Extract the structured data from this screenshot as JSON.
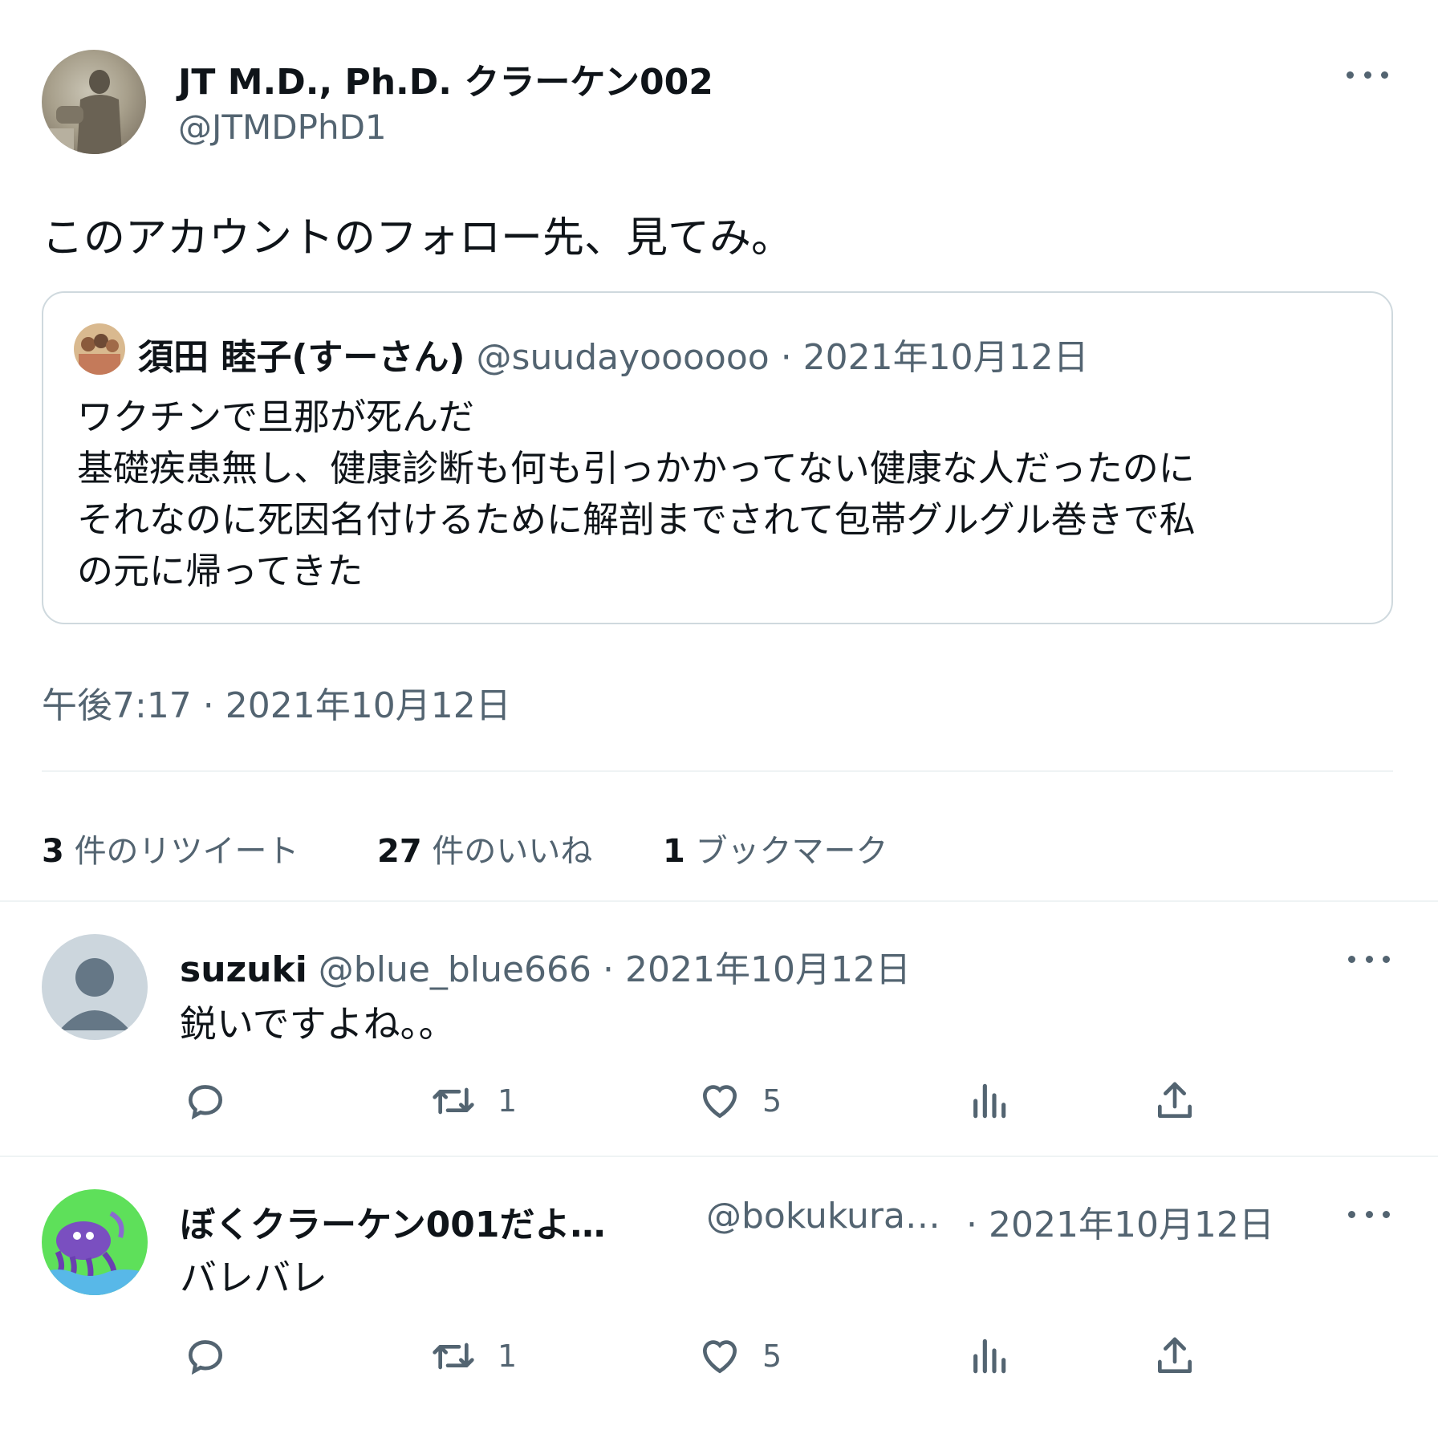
{
  "main_tweet": {
    "display_name": "JT M.D., Ph.D. クラーケン002",
    "handle": "@JTMDPhD1",
    "text": "このアカウントのフォロー先、見てみ。",
    "timestamp": "午後7:17 · 2021年10月12日"
  },
  "quoted_tweet": {
    "display_name": "須田 睦子(すーさん)",
    "handle": "@suudayoooooo",
    "date": "· 2021年10月12日",
    "lines": [
      "ワクチンで旦那が死んだ",
      "基礎疾患無し、健康診断も何も引っかかってない健康な人だったのに",
      "それなのに死因名付けるために解剖までされて包帯グルグル巻きで私",
      "の元に帰ってきた"
    ]
  },
  "stats": {
    "retweets_count": "3",
    "retweets_label": "件のリツイート",
    "likes_count": "27",
    "likes_label": "件のいいね",
    "bookmarks_count": "1",
    "bookmarks_label": "ブックマーク"
  },
  "replies": [
    {
      "display_name": "suzuki",
      "handle": "@blue_blue666",
      "date": "· 2021年10月12日",
      "text": "鋭いですよね。。",
      "retweets": "1",
      "likes": "5"
    },
    {
      "display_name": "ぼくクラーケン001だよ…",
      "handle": "@bokukura…",
      "date": "· 2021年10月12日",
      "text": "バレバレ",
      "retweets": "1",
      "likes": "5"
    }
  ],
  "icons": [
    "more-icon",
    "reply-icon",
    "retweet-icon",
    "like-icon",
    "views-icon",
    "share-icon"
  ],
  "colors": {
    "text": "#0f1419",
    "secondary": "#536471",
    "border": "#cfd9de",
    "divider": "#eff3f4",
    "reply2_avatar_bg": "#5ee05a"
  }
}
